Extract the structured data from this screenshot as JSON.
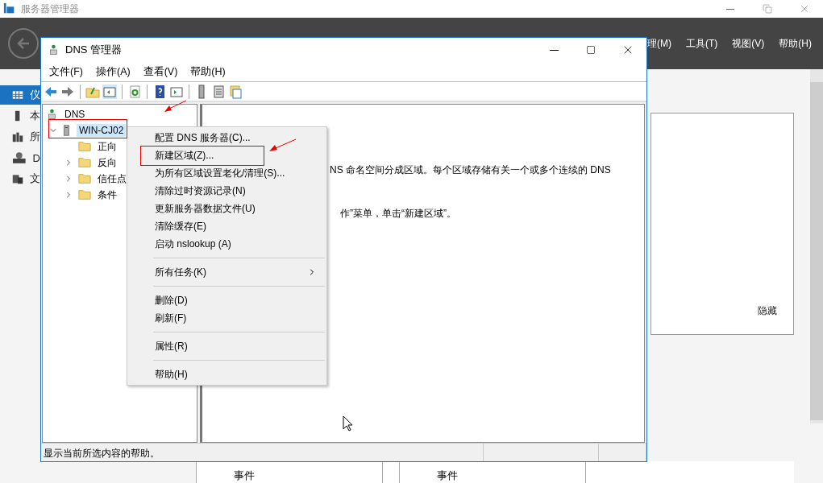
{
  "app": {
    "title": "服务器管理器",
    "menu": [
      "理(M)",
      "工具(T)",
      "视图(V)",
      "帮助(H)"
    ],
    "sidebar": [
      {
        "label": "仪",
        "selected": true
      },
      {
        "label": "本",
        "selected": false
      },
      {
        "label": "所",
        "selected": false
      },
      {
        "label": "D",
        "selected": false
      },
      {
        "label": "文",
        "selected": false
      }
    ],
    "panel": {
      "link": "隐藏"
    },
    "tiles": [
      "事件",
      "事件"
    ]
  },
  "dns_window": {
    "title": "DNS 管理器",
    "menu": [
      "文件(F)",
      "操作(A)",
      "查看(V)",
      "帮助(H)"
    ],
    "tree": {
      "label": "DNS",
      "children": [
        {
          "label": "WIN-CJ02",
          "selected": true,
          "expanded": true,
          "children": [
            {
              "label": "正向",
              "has_children": false
            },
            {
              "label": "反向",
              "has_children": true
            },
            {
              "label": "信任点",
              "has_children": true
            },
            {
              "label": "条件",
              "has_children": true
            }
          ]
        }
      ]
    },
    "details": [
      "NS 命名空间分成区域。每个区域存储有关一个或多个连续的 DNS",
      "作”菜单，单击“新建区域”。"
    ],
    "status_bar": "显示当前所选内容的帮助。"
  },
  "context_menu": {
    "items": [
      {
        "kind": "item",
        "label": "配置 DNS 服务器(C)...",
        "annotated": false
      },
      {
        "kind": "item",
        "label": "新建区域(Z)...",
        "annotated": true
      },
      {
        "kind": "item",
        "label": "为所有区域设置老化/清理(S)...",
        "annotated": false
      },
      {
        "kind": "item",
        "label": "清除过时资源记录(N)",
        "annotated": false
      },
      {
        "kind": "item",
        "label": "更新服务器数据文件(U)",
        "annotated": false
      },
      {
        "kind": "item",
        "label": "清除缓存(E)",
        "annotated": false
      },
      {
        "kind": "item",
        "label": "启动 nslookup (A)",
        "annotated": false
      },
      {
        "kind": "separator"
      },
      {
        "kind": "submenu",
        "label": "所有任务(K)",
        "annotated": false
      },
      {
        "kind": "separator"
      },
      {
        "kind": "item",
        "label": "删除(D)",
        "annotated": false
      },
      {
        "kind": "item",
        "label": "刷新(F)",
        "annotated": false
      },
      {
        "kind": "separator"
      },
      {
        "kind": "item",
        "label": "属性(R)",
        "annotated": false
      },
      {
        "kind": "separator"
      },
      {
        "kind": "item",
        "label": "帮助(H)",
        "annotated": false
      }
    ]
  }
}
